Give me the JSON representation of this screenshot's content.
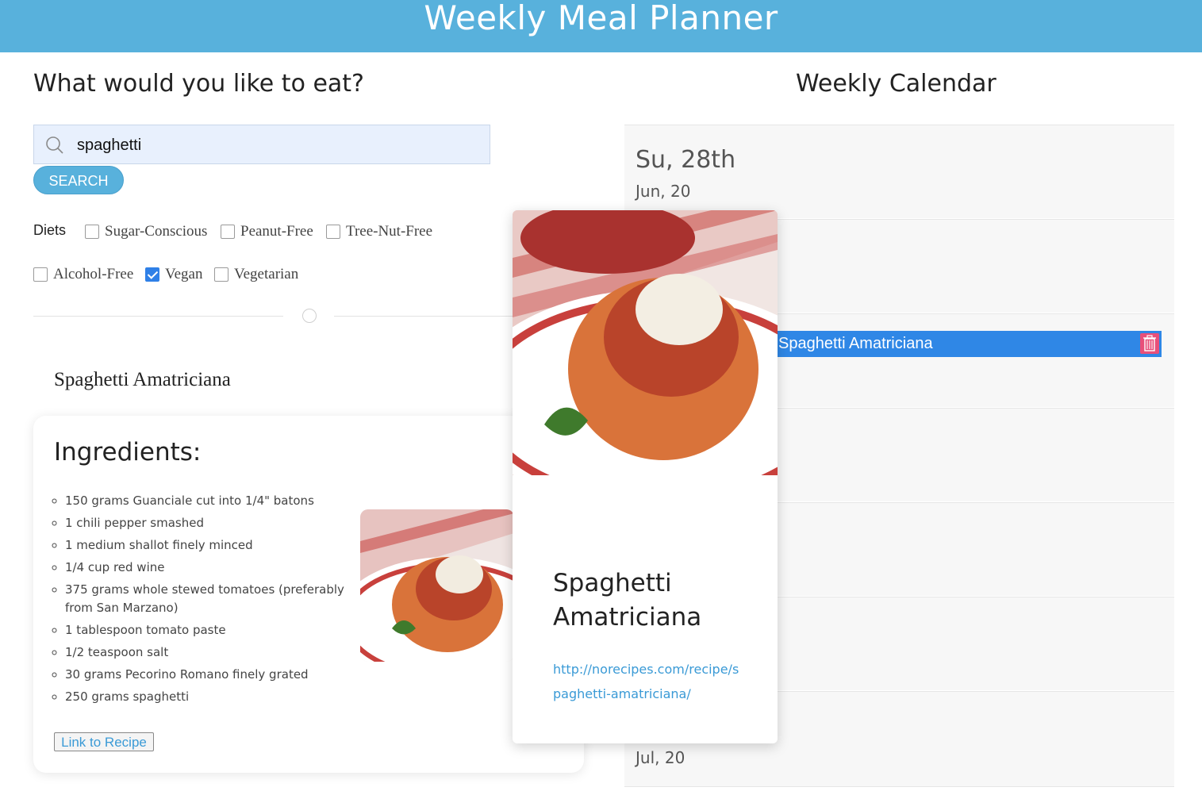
{
  "app": {
    "title": "Weekly Meal Planner"
  },
  "search": {
    "heading": "What would you like to eat?",
    "value": "spaghetti",
    "button": "SEARCH",
    "diets_label": "Diets",
    "diets": [
      {
        "label": "Sugar-Conscious",
        "checked": false
      },
      {
        "label": "Peanut-Free",
        "checked": false
      },
      {
        "label": "Tree-Nut-Free",
        "checked": false
      },
      {
        "label": "Alcohol-Free",
        "checked": false
      },
      {
        "label": "Vegan",
        "checked": true
      },
      {
        "label": "Vegetarian",
        "checked": false
      }
    ]
  },
  "result": {
    "title": "Spaghetti Amatriciana",
    "ingredients_heading": "Ingredients:",
    "ingredients": [
      "150 grams Guanciale cut into 1/4\" batons",
      "1 chili pepper smashed",
      "1 medium shallot finely minced",
      "1/4 cup red wine",
      "375 grams whole stewed tomatoes (preferably from San Marzano)",
      "1 tablespoon tomato paste",
      "1/2 teaspoon salt",
      "30 grams Pecorino Romano finely grated",
      "250 grams spaghetti"
    ],
    "link_button": "Link to Recipe"
  },
  "popup": {
    "title": "Spaghetti Amatriciana",
    "url": "http://norecipes.com/recipe/spaghetti-amatriciana/"
  },
  "calendar": {
    "heading": "Weekly Calendar",
    "days": [
      {
        "name": "Su, 28th",
        "date": "Jun, 20"
      },
      {
        "name": "",
        "date": ""
      },
      {
        "name": "",
        "date": "",
        "meal": "Spaghetti Amatriciana"
      },
      {
        "name": "",
        "date": ""
      },
      {
        "name": "",
        "date": ""
      },
      {
        "name": "",
        "date": ""
      },
      {
        "name": "",
        "date": "Jul, 20"
      }
    ]
  },
  "colors": {
    "header": "#58b1dc",
    "meal_bar": "#2f87e6",
    "trash": "#e8507a",
    "link": "#3a9ad6"
  },
  "icons": [
    "search-icon",
    "trash-icon"
  ]
}
